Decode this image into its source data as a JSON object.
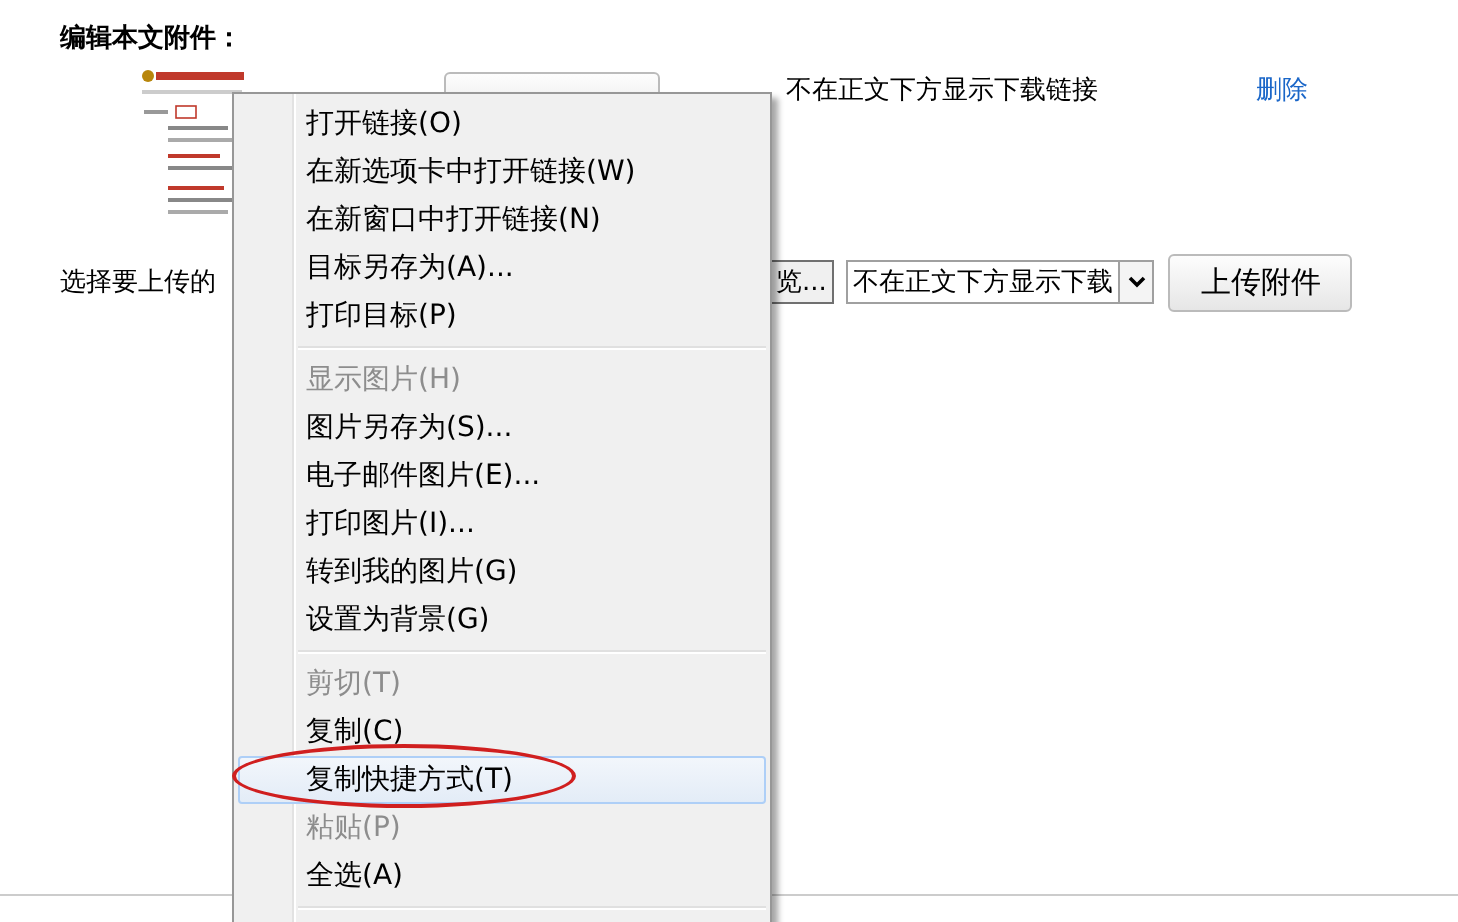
{
  "heading": "编辑本文附件：",
  "attachment": {
    "display_option": "不在正文下方显示下载链接",
    "delete_link": "删除"
  },
  "upload": {
    "label": "选择要上传的",
    "browse_button": "览...",
    "display_select": "不在正文下方显示下载",
    "upload_button": "上传附件"
  },
  "context_menu": {
    "items": [
      {
        "kind": "item",
        "label": "打开链接(O)",
        "disabled": false,
        "selected": false
      },
      {
        "kind": "item",
        "label": "在新选项卡中打开链接(W)",
        "disabled": false,
        "selected": false
      },
      {
        "kind": "item",
        "label": "在新窗口中打开链接(N)",
        "disabled": false,
        "selected": false
      },
      {
        "kind": "item",
        "label": "目标另存为(A)...",
        "disabled": false,
        "selected": false
      },
      {
        "kind": "item",
        "label": "打印目标(P)",
        "disabled": false,
        "selected": false
      },
      {
        "kind": "separator"
      },
      {
        "kind": "item",
        "label": "显示图片(H)",
        "disabled": true,
        "selected": false
      },
      {
        "kind": "item",
        "label": "图片另存为(S)...",
        "disabled": false,
        "selected": false
      },
      {
        "kind": "item",
        "label": "电子邮件图片(E)...",
        "disabled": false,
        "selected": false
      },
      {
        "kind": "item",
        "label": "打印图片(I)...",
        "disabled": false,
        "selected": false
      },
      {
        "kind": "item",
        "label": "转到我的图片(G)",
        "disabled": false,
        "selected": false
      },
      {
        "kind": "item",
        "label": "设置为背景(G)",
        "disabled": false,
        "selected": false
      },
      {
        "kind": "separator"
      },
      {
        "kind": "item",
        "label": "剪切(T)",
        "disabled": true,
        "selected": false
      },
      {
        "kind": "item",
        "label": "复制(C)",
        "disabled": false,
        "selected": false
      },
      {
        "kind": "item",
        "label": "复制快捷方式(T)",
        "disabled": false,
        "selected": true,
        "circled": true
      },
      {
        "kind": "item",
        "label": "粘贴(P)",
        "disabled": true,
        "selected": false
      },
      {
        "kind": "item",
        "label": "全选(A)",
        "disabled": false,
        "selected": false
      },
      {
        "kind": "separator"
      }
    ]
  }
}
